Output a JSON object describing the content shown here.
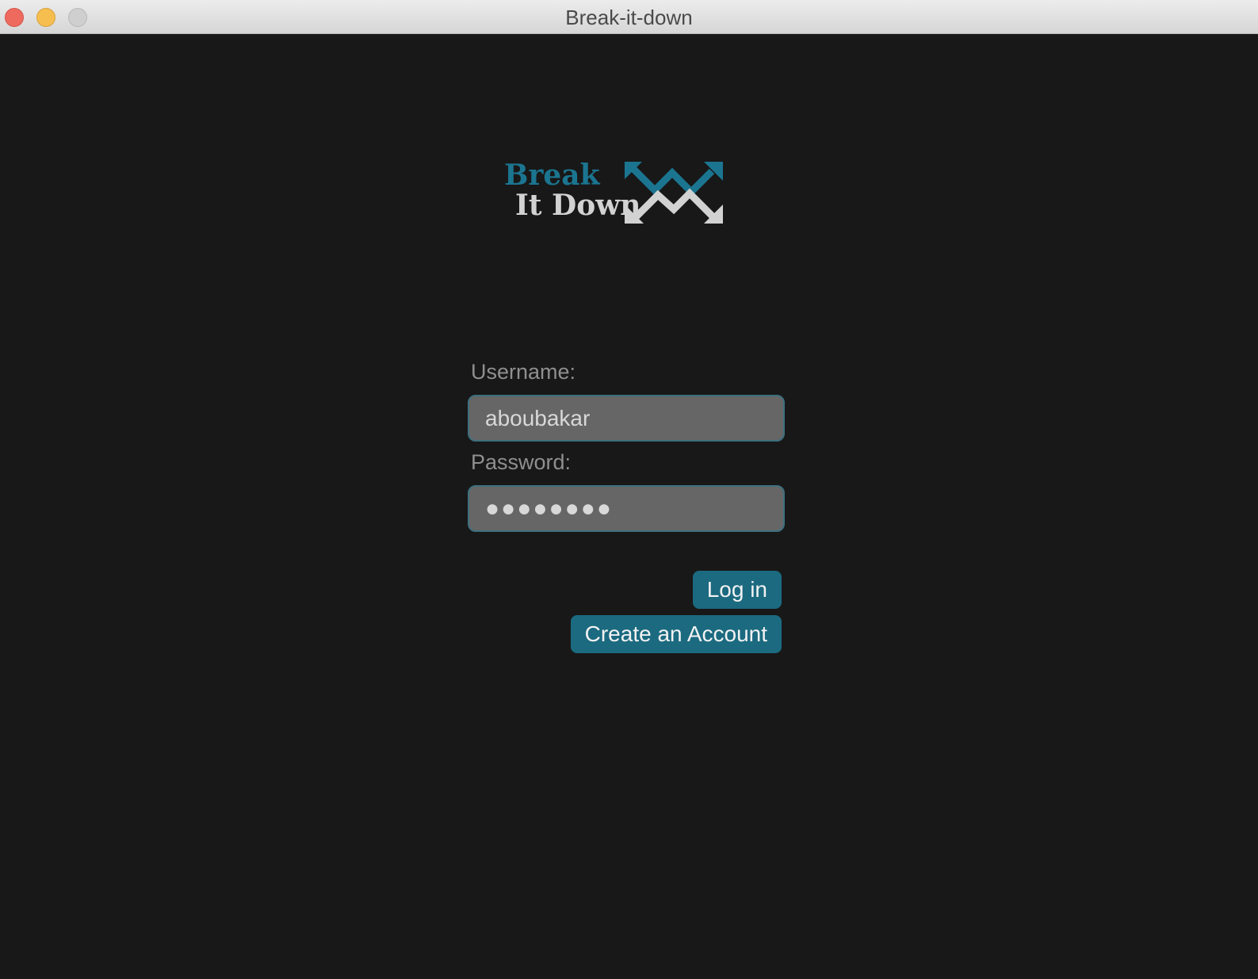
{
  "window": {
    "title": "Break-it-down"
  },
  "logo": {
    "line1": "Break",
    "line2": "It Down",
    "colors": {
      "primary": "#1b7590",
      "secondary": "#d2d2d2"
    }
  },
  "form": {
    "username_label": "Username:",
    "username_value": "aboubakar",
    "password_label": "Password:",
    "password_value": "●●●●●●●●"
  },
  "buttons": {
    "login_label": "Log in",
    "create_account_label": "Create an Account"
  },
  "colors": {
    "background": "#181818",
    "field_background": "#666666",
    "field_border": "#3d6f7e",
    "button": "#1b6a80"
  }
}
